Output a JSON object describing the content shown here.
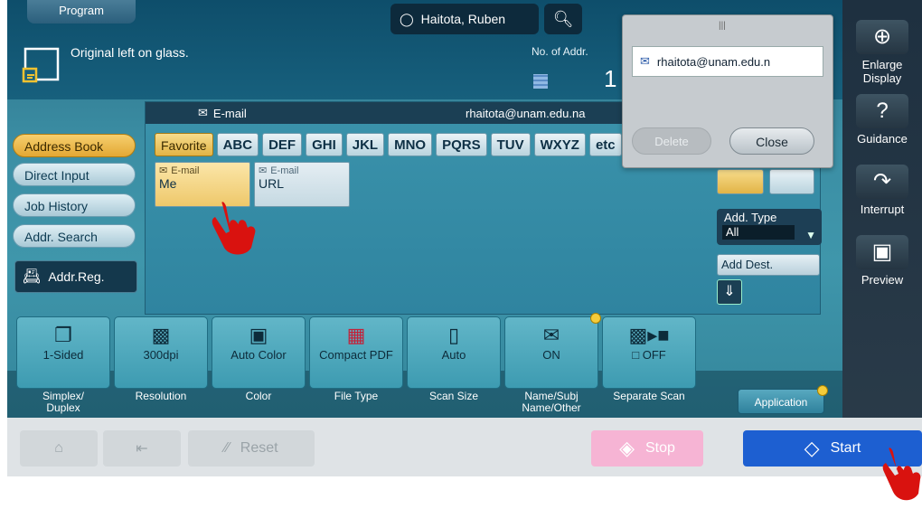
{
  "header": {
    "program_tab": "Program",
    "original_status": "Original left on glass.",
    "user": "Haitota, Ruben",
    "num_addr_label": "No. of Addr.",
    "num_addr_value": "1"
  },
  "right_panel": {
    "enlarge": "Enlarge Display",
    "guidance": "Guidance",
    "interrupt": "Interrupt",
    "preview": "Preview"
  },
  "nav": {
    "items": [
      "Address Book",
      "Direct Input",
      "Job History",
      "Addr. Search"
    ],
    "addr_reg": "Addr.Reg."
  },
  "dest_bar": {
    "type": "E-mail",
    "address": "rhaitota@unam.edu.na"
  },
  "tabs": [
    "Favorite",
    "ABC",
    "DEF",
    "GHI",
    "JKL",
    "MNO",
    "PQRS",
    "TUV",
    "WXYZ",
    "etc"
  ],
  "cards": [
    {
      "kind": "E-mail",
      "name": "Me"
    },
    {
      "kind": "E-mail",
      "name": "URL"
    }
  ],
  "add_type": {
    "label": "Add. Type",
    "value": "All"
  },
  "add_dest": "Add Dest.",
  "popup": {
    "email": "rhaitota@unam.edu.n",
    "delete": "Delete",
    "close": "Close"
  },
  "settings": [
    {
      "value": "1-Sided",
      "label": "Simplex/\nDuplex"
    },
    {
      "value": "300dpi",
      "label": "Resolution"
    },
    {
      "value": "Auto Color",
      "label": "Color"
    },
    {
      "value": "Compact PDF",
      "label": "File Type"
    },
    {
      "value": "Auto",
      "label": "Scan Size"
    },
    {
      "value": "ON",
      "label": "Name/Subj\nName/Other"
    },
    {
      "value": "OFF",
      "label": "Separate Scan"
    }
  ],
  "application": "Application",
  "bottom": {
    "reset": "Reset",
    "stop": "Stop",
    "start": "Start"
  },
  "colors": {
    "start": "#1d5fd1",
    "stop": "#f6b4d4",
    "favorite": "#e2b446"
  }
}
